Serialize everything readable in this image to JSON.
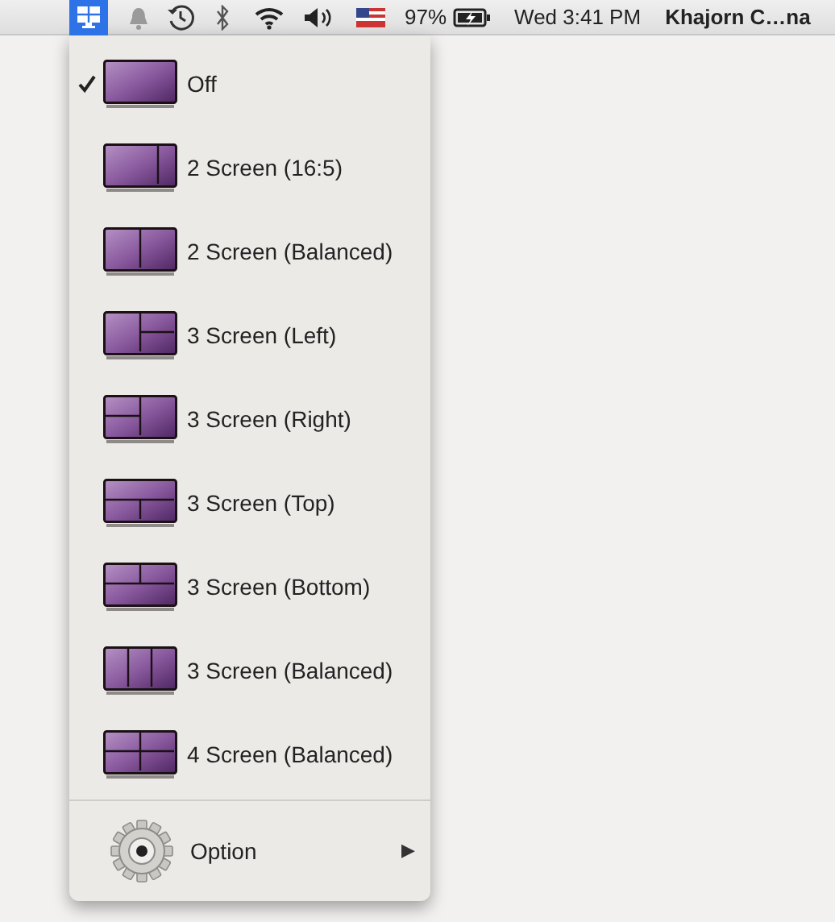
{
  "menu_bar": {
    "app_icon": {
      "selected": true
    },
    "battery_percent": "97%",
    "clock": "Wed 3:41 PM",
    "user": "Khajorn C…na"
  },
  "menu": {
    "items": [
      {
        "label": "Off",
        "kind": "full",
        "checked": true
      },
      {
        "label": "2 Screen (16:5)",
        "kind": "split-wide",
        "checked": false
      },
      {
        "label": "2 Screen (Balanced)",
        "kind": "split-half",
        "checked": false
      },
      {
        "label": "3 Screen (Left)",
        "kind": "three-left",
        "checked": false
      },
      {
        "label": "3 Screen (Right)",
        "kind": "three-right",
        "checked": false
      },
      {
        "label": "3 Screen (Top)",
        "kind": "three-top",
        "checked": false
      },
      {
        "label": "3 Screen (Bottom)",
        "kind": "three-bottom",
        "checked": false
      },
      {
        "label": "3 Screen (Balanced)",
        "kind": "three-columns",
        "checked": false
      },
      {
        "label": "4 Screen (Balanced)",
        "kind": "four-grid",
        "checked": false
      }
    ],
    "option": {
      "label": "Option",
      "arrow": "▶"
    }
  }
}
